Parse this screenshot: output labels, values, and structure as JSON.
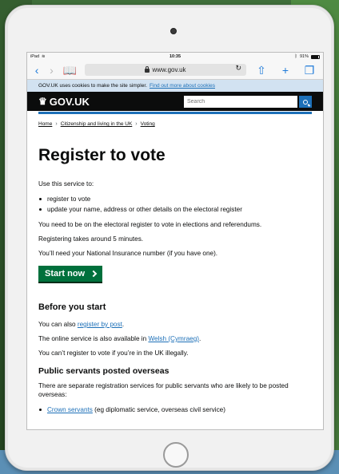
{
  "statusbar": {
    "device": "iPad",
    "time": "10:35",
    "battery": "91%"
  },
  "browser": {
    "url": "www.gov.uk"
  },
  "cookie_banner": {
    "text": "GOV.UK uses cookies to make the site simpler.",
    "link": "Find out more about cookies"
  },
  "header": {
    "logo": "GOV.UK",
    "search_placeholder": "Search"
  },
  "breadcrumbs": [
    "Home",
    "Citizenship and living in the UK",
    "Voting"
  ],
  "main": {
    "title": "Register to vote",
    "intro": "Use this service to:",
    "bullets": [
      "register to vote",
      "update your name, address or other details on the electoral register"
    ],
    "para1": "You need to be on the electoral register to vote in elections and referendums.",
    "para2": "Registering takes around 5 minutes.",
    "para3": "You’ll need your National Insurance number (if you have one).",
    "start_button": "Start now"
  },
  "before": {
    "heading": "Before you start",
    "p1_pre": "You can also ",
    "p1_link": "register by post",
    "p1_post": ".",
    "p2_pre": "The online service is also available in ",
    "p2_link": "Welsh (Cymraeg)",
    "p2_post": ".",
    "p3": "You can’t register to vote if you’re in the UK illegally."
  },
  "overseas": {
    "heading": "Public servants posted overseas",
    "text": "There are separate registration services for public servants who are likely to be posted overseas:",
    "item_link": "Crown servants",
    "item_rest": " (eg diplomatic service, overseas civil service)"
  }
}
